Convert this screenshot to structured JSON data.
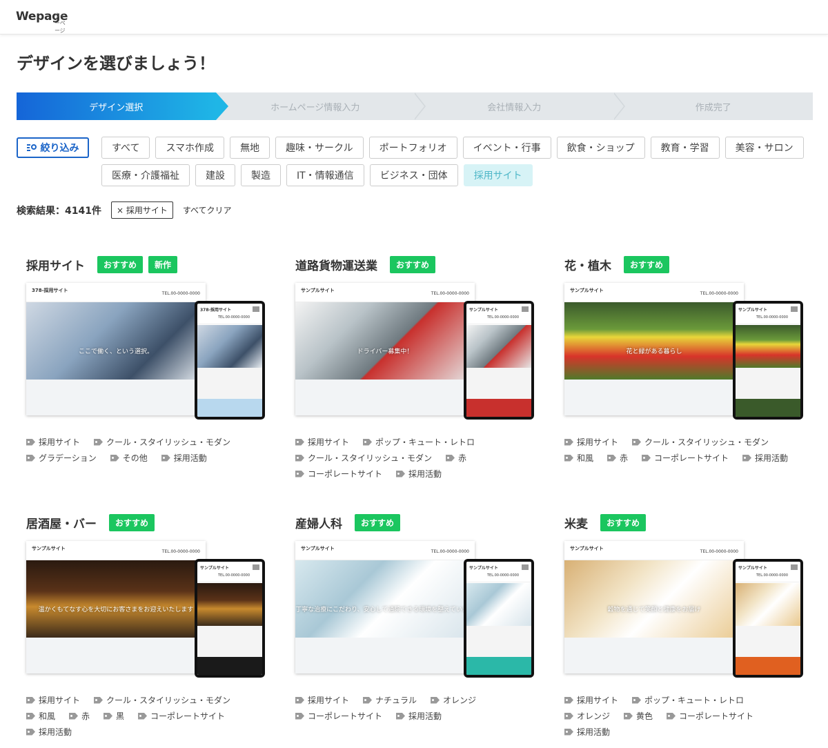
{
  "header": {
    "logo": "Wepage",
    "logo_ruby": "ウィーページ"
  },
  "page_title": "デザインを選びましょう！",
  "steps": [
    "デザイン選択",
    "ホームページ情報入力",
    "会社情報入力",
    "作成完了"
  ],
  "filter_button": "絞り込み",
  "categories": [
    "すべて",
    "スマホ作成",
    "無地",
    "趣味・サークル",
    "ポートフォリオ",
    "イベント・行事",
    "飲食・ショップ",
    "教育・学習",
    "美容・サロン",
    "医療・介護福祉",
    "建設",
    "製造",
    "IT・情報通信",
    "ビジネス・団体",
    "採用サイト"
  ],
  "selected_category": "採用サイト",
  "results": {
    "count_label": "検索結果：4141件",
    "active_chip": "× 採用サイト",
    "clear_all": "すべてクリア"
  },
  "cards": [
    {
      "title": "採用サイト",
      "badges": [
        "おすすめ",
        "新作"
      ],
      "desk_site": "378-採用サイト",
      "desk_tel": "TEL.00-0000-0000",
      "desk_caption": "ここで働く、という選択。",
      "phone_site": "378-採用サイト",
      "phone_tel": "TEL.00-0000-0000",
      "tags": [
        "採用サイト",
        "クール・スタイリッシュ・モダン",
        "グラデーション",
        "その他",
        "採用活動"
      ]
    },
    {
      "title": "道路貨物運送業",
      "badges": [
        "おすすめ"
      ],
      "desk_site": "サンプルサイト",
      "desk_tel": "TEL.00-0000-0000",
      "desk_caption": "ドライバー募集中！",
      "phone_site": "サンプルサイト",
      "phone_tel": "TEL.00-0000-0000",
      "tags": [
        "採用サイト",
        "ポップ・キュート・レトロ",
        "クール・スタイリッシュ・モダン",
        "赤",
        "コーポレートサイト",
        "採用活動"
      ]
    },
    {
      "title": "花・植木",
      "badges": [
        "おすすめ"
      ],
      "desk_site": "サンプルサイト",
      "desk_tel": "TEL.00-0000-0000",
      "desk_caption": "花と緑がある暮らし",
      "phone_site": "サンプルサイト",
      "phone_tel": "TEL.00-0000-0000",
      "tags": [
        "採用サイト",
        "クール・スタイリッシュ・モダン",
        "和風",
        "赤",
        "コーポレートサイト",
        "採用活動"
      ]
    },
    {
      "title": "居酒屋・バー",
      "badges": [
        "おすすめ"
      ],
      "desk_site": "サンプルサイト",
      "desk_tel": "TEL.00-0000-0000",
      "desk_caption": "温かくもてなす心を大切にお客さまをお迎えいたします",
      "phone_site": "サンプルサイト",
      "phone_tel": "TEL.00-0000-0000",
      "tags": [
        "採用サイト",
        "クール・スタイリッシュ・モダン",
        "和風",
        "赤",
        "黒",
        "コーポレートサイト",
        "採用活動"
      ]
    },
    {
      "title": "産婦人科",
      "badges": [
        "おすすめ"
      ],
      "desk_site": "サンプルサイト",
      "desk_tel": "TEL.00-0000-0000",
      "desk_caption": "丁寧な治療にこだわり、安心して通院できる環境を整えています",
      "phone_site": "サンプルサイト",
      "phone_tel": "TEL.00-0000-0000",
      "tags": [
        "採用サイト",
        "ナチュラル",
        "オレンジ",
        "コーポレートサイト",
        "採用活動"
      ]
    },
    {
      "title": "米麦",
      "badges": [
        "おすすめ"
      ],
      "desk_site": "サンプルサイト",
      "desk_tel": "TEL.00-0000-0000",
      "desk_caption": "穀物を通じて笑顔と健康をお届け",
      "phone_site": "サンプルサイト",
      "phone_tel": "TEL.00-0000-0000",
      "tags": [
        "採用サイト",
        "ポップ・キュート・レトロ",
        "オレンジ",
        "黄色",
        "コーポレートサイト",
        "採用活動"
      ]
    }
  ],
  "colors": {
    "accent": "#1a64c8",
    "badge_green": "#1bc65f",
    "step_active_start": "#1565d8",
    "step_active_end": "#1fb6e6",
    "selected_chip_bg": "#d7f3f6"
  }
}
